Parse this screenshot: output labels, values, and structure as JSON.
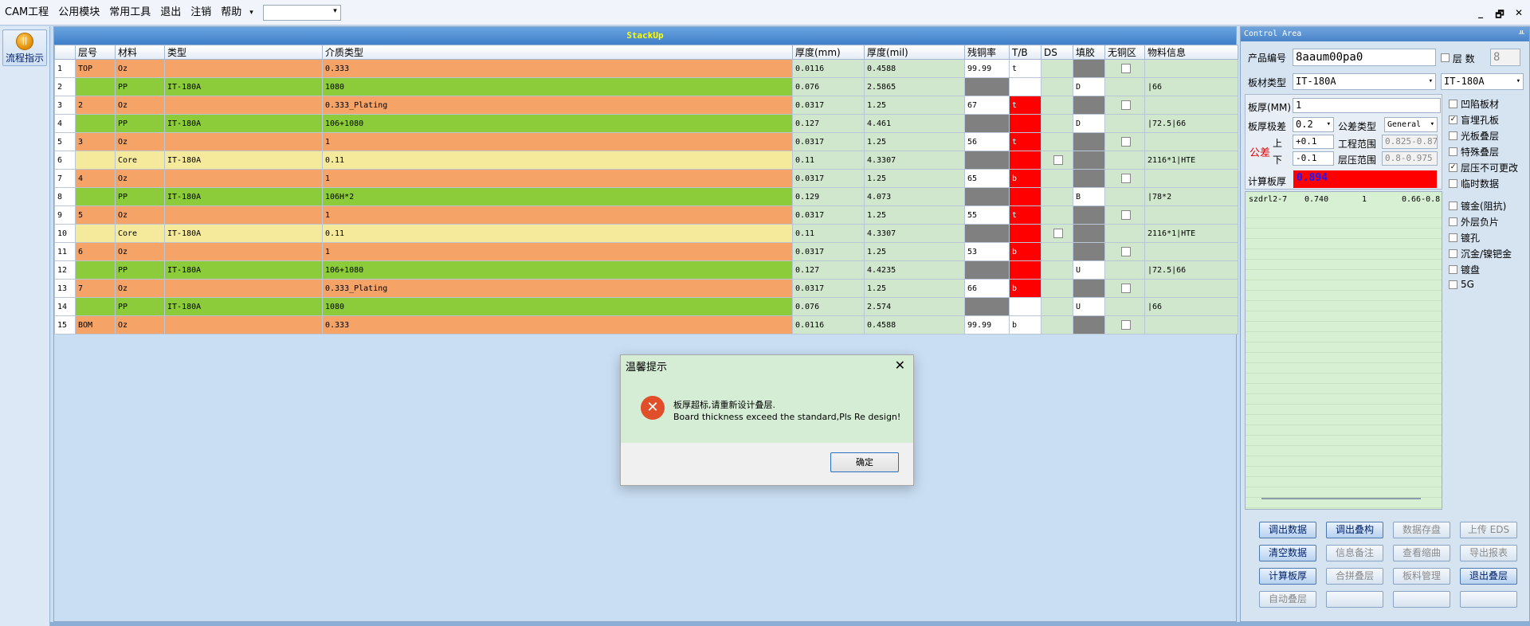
{
  "menu": {
    "items": [
      "CAM工程",
      "公用模块",
      "常用工具",
      "退出",
      "注销",
      "帮助"
    ],
    "more_arrow": "▾",
    "combo_value": ""
  },
  "window_controls": [
    "_",
    "🗗",
    "✕"
  ],
  "left": {
    "flow_label": "流程指示"
  },
  "stackup": {
    "title": "StackUp",
    "columns": [
      "",
      "层号",
      "材料",
      "类型",
      "介质类型",
      "厚度(mm)",
      "厚度(mil)",
      "残铜率",
      "T/B",
      "DS",
      "填胶",
      "无铜区",
      "物料信息"
    ],
    "rows": [
      {
        "n": "1",
        "layer": "TOP",
        "mat": "Oz",
        "type": "",
        "diel": "0.333",
        "mm": "0.0116",
        "mil": "0.4588",
        "cu": "99.99",
        "tb": "t",
        "info": ""
      },
      {
        "n": "2",
        "layer": "",
        "mat": "PP",
        "type": "IT-180A",
        "diel": "1080",
        "mm": "0.076",
        "mil": "2.5865",
        "cu": "",
        "tb": "",
        "fill": "D",
        "info": "|66"
      },
      {
        "n": "3",
        "layer": "2",
        "mat": "Oz",
        "type": "",
        "diel": "0.333_Plating",
        "mm": "0.0317",
        "mil": "1.25",
        "cu": "67",
        "tb": "t",
        "info": ""
      },
      {
        "n": "4",
        "layer": "",
        "mat": "PP",
        "type": "IT-180A",
        "diel": "106+1080",
        "mm": "0.127",
        "mil": "4.461",
        "cu": "",
        "tb": "",
        "fill": "D",
        "info": "|72.5|66"
      },
      {
        "n": "5",
        "layer": "3",
        "mat": "Oz",
        "type": "",
        "diel": "1",
        "mm": "0.0317",
        "mil": "1.25",
        "cu": "56",
        "tb": "t",
        "info": ""
      },
      {
        "n": "6",
        "layer": "",
        "mat": "Core",
        "type": "IT-180A",
        "diel": "0.11",
        "mm": "0.11",
        "mil": "4.3307",
        "cu": "",
        "tb": "",
        "info": "2116*1|HTE"
      },
      {
        "n": "7",
        "layer": "4",
        "mat": "Oz",
        "type": "",
        "diel": "1",
        "mm": "0.0317",
        "mil": "1.25",
        "cu": "65",
        "tb": "b",
        "info": ""
      },
      {
        "n": "8",
        "layer": "",
        "mat": "PP",
        "type": "IT-180A",
        "diel": "106H*2",
        "mm": "0.129",
        "mil": "4.073",
        "cu": "",
        "tb": "",
        "fill": "B",
        "info": "|78*2"
      },
      {
        "n": "9",
        "layer": "5",
        "mat": "Oz",
        "type": "",
        "diel": "1",
        "mm": "0.0317",
        "mil": "1.25",
        "cu": "55",
        "tb": "t",
        "info": ""
      },
      {
        "n": "10",
        "layer": "",
        "mat": "Core",
        "type": "IT-180A",
        "diel": "0.11",
        "mm": "0.11",
        "mil": "4.3307",
        "cu": "",
        "tb": "",
        "info": "2116*1|HTE"
      },
      {
        "n": "11",
        "layer": "6",
        "mat": "Oz",
        "type": "",
        "diel": "1",
        "mm": "0.0317",
        "mil": "1.25",
        "cu": "53",
        "tb": "b",
        "info": ""
      },
      {
        "n": "12",
        "layer": "",
        "mat": "PP",
        "type": "IT-180A",
        "diel": "106+1080",
        "mm": "0.127",
        "mil": "4.4235",
        "cu": "",
        "tb": "",
        "fill": "U",
        "info": "|72.5|66"
      },
      {
        "n": "13",
        "layer": "7",
        "mat": "Oz",
        "type": "",
        "diel": "0.333_Plating",
        "mm": "0.0317",
        "mil": "1.25",
        "cu": "66",
        "tb": "b",
        "info": ""
      },
      {
        "n": "14",
        "layer": "",
        "mat": "PP",
        "type": "IT-180A",
        "diel": "1080",
        "mm": "0.076",
        "mil": "2.574",
        "cu": "",
        "tb": "",
        "fill": "U",
        "info": "|66"
      },
      {
        "n": "15",
        "layer": "BOM",
        "mat": "Oz",
        "type": "",
        "diel": "0.333",
        "mm": "0.0116",
        "mil": "0.4588",
        "cu": "99.99",
        "tb": "b",
        "info": ""
      }
    ]
  },
  "dialog": {
    "title": "温馨提示",
    "close": "✕",
    "icon": "✕",
    "message_cn": "板厚超标,请重新设计叠层.",
    "message_en": "Board thickness exceed the standard,Pls Re design!",
    "ok": "确定"
  },
  "control": {
    "title": "Control Area",
    "pin": "ᚇ",
    "product_label": "产品编号",
    "product_value": "8aaum00pa0",
    "layers_label": "层 数",
    "layers_value": "8",
    "board_type_label": "板材类型",
    "board_type_value": "IT-180A",
    "board_type_value2": "IT-180A",
    "thickness_label": "板厚(MM)",
    "thickness_value": "1",
    "tol_label": "板厚极差",
    "tol_value": "0.2",
    "tol_type_label": "公差类型",
    "tol_type_value": "General",
    "gongcha": "公差",
    "upper_label": "上",
    "lower_label": "下",
    "upper_value": "+0.1",
    "lower_value": "-0.1",
    "eng_range_label": "工程范围",
    "eng_range_value": "0.825-0.875",
    "press_range_label": "层压范围",
    "press_range_value": "0.8-0.975",
    "calc_label": "计算板厚",
    "calc_value": "0.894",
    "list_row": [
      "szdrl2-7",
      "0.740",
      "1",
      "0.66-0.8"
    ],
    "checks": [
      {
        "label": "凹陷板材",
        "checked": false
      },
      {
        "label": "盲埋孔板",
        "checked": true
      },
      {
        "label": "光板叠层",
        "checked": false
      },
      {
        "label": "特殊叠层",
        "checked": false
      },
      {
        "label": "层压不可更改",
        "checked": true
      },
      {
        "label": "临时数据",
        "checked": false
      },
      {
        "label": "镀金(阻抗)",
        "checked": false
      },
      {
        "label": "外层负片",
        "checked": false
      },
      {
        "label": "镀孔",
        "checked": false
      },
      {
        "label": "沉金/镍钯金",
        "checked": false
      },
      {
        "label": "镀盘",
        "checked": false
      },
      {
        "label": "5G",
        "checked": false
      }
    ],
    "buttons": [
      {
        "label": "调出数据",
        "active": true
      },
      {
        "label": "调出叠构",
        "active": true
      },
      {
        "label": "数据存盘",
        "active": false
      },
      {
        "label": "上传 EDS",
        "active": false
      },
      {
        "label": "清空数据",
        "active": true
      },
      {
        "label": "信息备注",
        "active": false
      },
      {
        "label": "查看缩曲",
        "active": false
      },
      {
        "label": "导出报表",
        "active": false
      },
      {
        "label": "计算板厚",
        "active": true
      },
      {
        "label": "合拼叠层",
        "active": false
      },
      {
        "label": "板料管理",
        "active": false
      },
      {
        "label": "退出叠层",
        "active": true
      },
      {
        "label": "自动叠层",
        "active": false
      },
      {
        "label": "",
        "active": false
      },
      {
        "label": "",
        "active": false
      },
      {
        "label": "",
        "active": false
      }
    ]
  }
}
